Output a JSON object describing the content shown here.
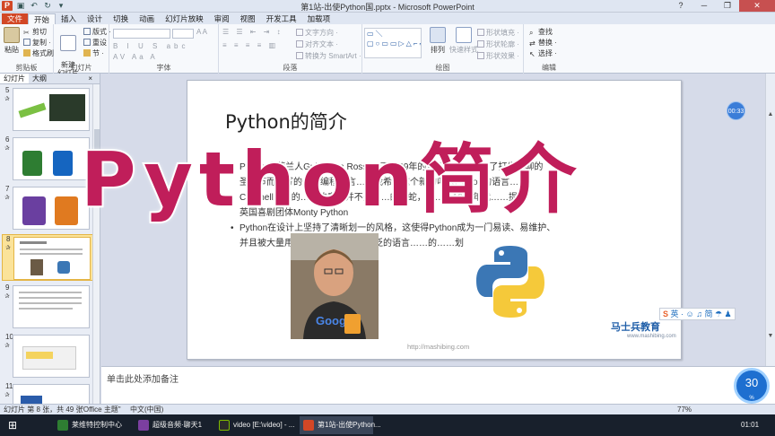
{
  "window": {
    "title": "第1站-出使Python国.pptx - Microsoft PowerPoint"
  },
  "ribbon": {
    "tabs": [
      "文件",
      "开始",
      "插入",
      "设计",
      "切换",
      "动画",
      "幻灯片放映",
      "审阅",
      "视图",
      "开发工具",
      "加载项"
    ],
    "active_tab": "开始",
    "clipboard": {
      "paste": "粘贴",
      "cut": "剪切",
      "copy": "复制 ·",
      "format_painter": "格式刷",
      "label": "剪贴板"
    },
    "slides": {
      "new_slide": "新建\n幻灯片 ·",
      "layout": "版式 ·",
      "reset": "重设",
      "section": "节 ·",
      "label": "幻灯片"
    },
    "font": {
      "label": "字体"
    },
    "paragraph": {
      "text_direction": "文字方向 ·",
      "align_text": "对齐文本 ·",
      "smartart": "转换为 SmartArt ·",
      "label": "段落"
    },
    "drawing": {
      "arrange": "排列",
      "quick_styles": "快速样式",
      "shape_fill": "形状填充 ·",
      "shape_outline": "形状轮廓 ·",
      "shape_effects": "形状效果 ·",
      "label": "绘图"
    },
    "editing": {
      "find": "查找",
      "replace": "替换 ·",
      "select": "选择 ·",
      "label": "编辑"
    }
  },
  "panel": {
    "tabs": [
      "幻灯片",
      "大纲"
    ],
    "close": "×",
    "slides": [
      {
        "num": "5",
        "sel": false
      },
      {
        "num": "6",
        "sel": false
      },
      {
        "num": "7",
        "sel": false
      },
      {
        "num": "8",
        "sel": true
      },
      {
        "num": "9",
        "sel": false
      },
      {
        "num": "10",
        "sel": false
      },
      {
        "num": "11",
        "sel": false
      }
    ]
  },
  "slide": {
    "title": "Python的简介",
    "bullet1_line1": "Python由荷兰人Guido van Rossum于1989年的圣诞节期间，为了打发无聊的",
    "bullet1_line2": "圣诞节而编写的一个编程语言……我希望这个新的叫做Python的语言……",
    "bullet1_line3": "C和shell之间的……的意思并不是……的蟒蛇，而……1970年代……提。",
    "bullet1_line4": "英国喜剧团体Monty Python",
    "bullet2_line1": "Python在设计上坚持了清晰划一的风格，这使得Python成为一门易读、易维护、",
    "bullet2_line2": "并且被大量用户所欢迎的、用途广泛的语言……的……划",
    "photo_caption": "Google",
    "url": "http://mashibing.com",
    "brand": "马士兵教育",
    "brand_sub": "www.mashibing.com"
  },
  "overlay": {
    "text": "Python简介"
  },
  "timer": "00:33",
  "ime": "英 · ☺ ♫ 简 ☂ ♟",
  "notes": {
    "placeholder": "单击此处添加备注"
  },
  "speed": {
    "value": "30",
    "unit": "%"
  },
  "status": {
    "slide_info": "幻灯片 第 8 张，共 49 张",
    "theme": "\"Office 主题\"",
    "language": "中文(中国)",
    "zoom": "77%"
  },
  "taskbar": {
    "items": [
      {
        "label": "莱维特控制中心",
        "active": false,
        "color": "#2e7d32"
      },
      {
        "label": "超级音频·聊天1",
        "active": false,
        "color": "#7b3fa0"
      },
      {
        "label": "video [E:\\video] - ...",
        "active": false,
        "color": "#2b2b2b"
      },
      {
        "label": "第1站-出使Python...",
        "active": true,
        "color": "#d24726"
      }
    ],
    "time": "01:01"
  },
  "colors": {
    "overlay": "#c01e5a",
    "file_tab": "#d24726",
    "accent": "#3b7dd8"
  }
}
